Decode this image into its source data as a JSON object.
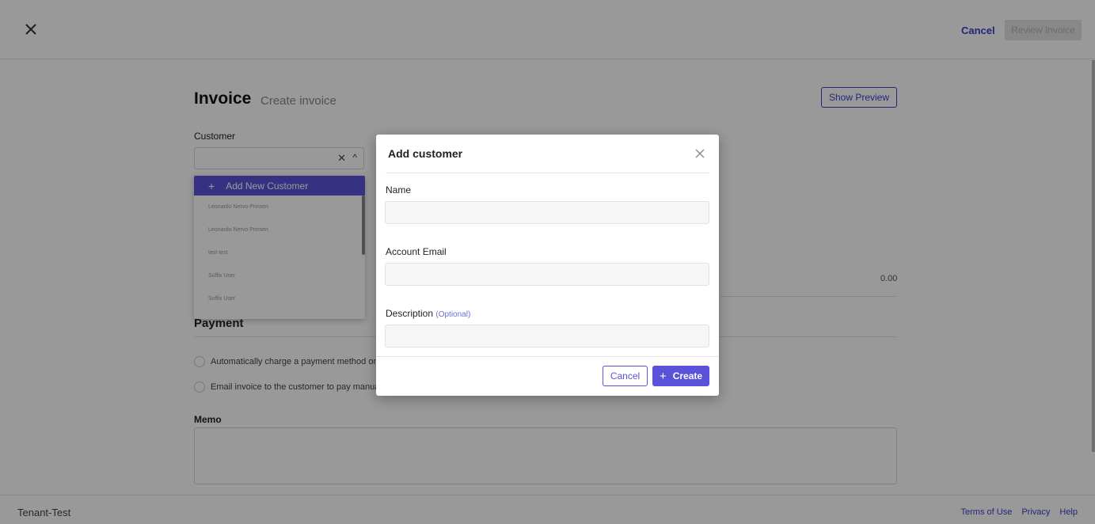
{
  "topbar": {
    "cancel_label": "Cancel",
    "review_label": "Review Invoice"
  },
  "page": {
    "title": "Invoice",
    "subtitle": "Create invoice",
    "show_preview_label": "Show Preview",
    "customer_label": "Customer",
    "total_value": "0.00"
  },
  "customer_dropdown": {
    "clear_icon": "close-icon",
    "toggle_icon": "chevron-up-icon",
    "add_label": "Add New Customer",
    "items": [
      "Leonardo Nervo Prinsen",
      "Leonardo Nervo Prinsen",
      "test test",
      "Suffix User",
      "Suffix User"
    ]
  },
  "payment": {
    "title": "Payment",
    "options": [
      "Automatically charge a payment method on",
      "Email invoice to the customer to pay manua"
    ]
  },
  "memo": {
    "label": "Memo"
  },
  "footer": {
    "tenant": "Tenant-Test",
    "links": [
      "Terms of Use",
      "Privacy",
      "Help"
    ]
  },
  "modal": {
    "title": "Add customer",
    "name_label": "Name",
    "email_label": "Account Email",
    "description_label": "Description",
    "description_optional": "(Optional)",
    "name_value": "",
    "email_value": "",
    "description_value": "",
    "cancel_label": "Cancel",
    "create_label": "Create"
  },
  "colors": {
    "accent": "#5a52d9",
    "link": "#3b3fc8",
    "overlay": "rgba(0,0,0,0.4)"
  }
}
